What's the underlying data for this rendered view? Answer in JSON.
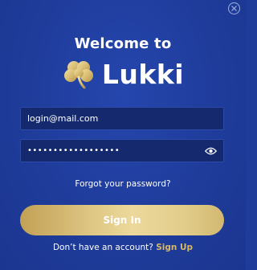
{
  "header": {
    "welcome_text": "Welcome to",
    "brand_name": "Lukki"
  },
  "icons": {
    "close": "close-icon",
    "logo": "shamrock-icon",
    "eye": "eye-icon"
  },
  "form": {
    "email_value": "login@mail.com",
    "password_masked": "••••••••••••••••••",
    "forgot_label": "Forgot your password?",
    "signin_label": "Sign In",
    "no_account_text": "Don’t have an account?",
    "signup_label": "Sign Up"
  },
  "colors": {
    "background": "#1f3c9b",
    "field_bg": "#152a6e",
    "gold": "#d6b867"
  }
}
